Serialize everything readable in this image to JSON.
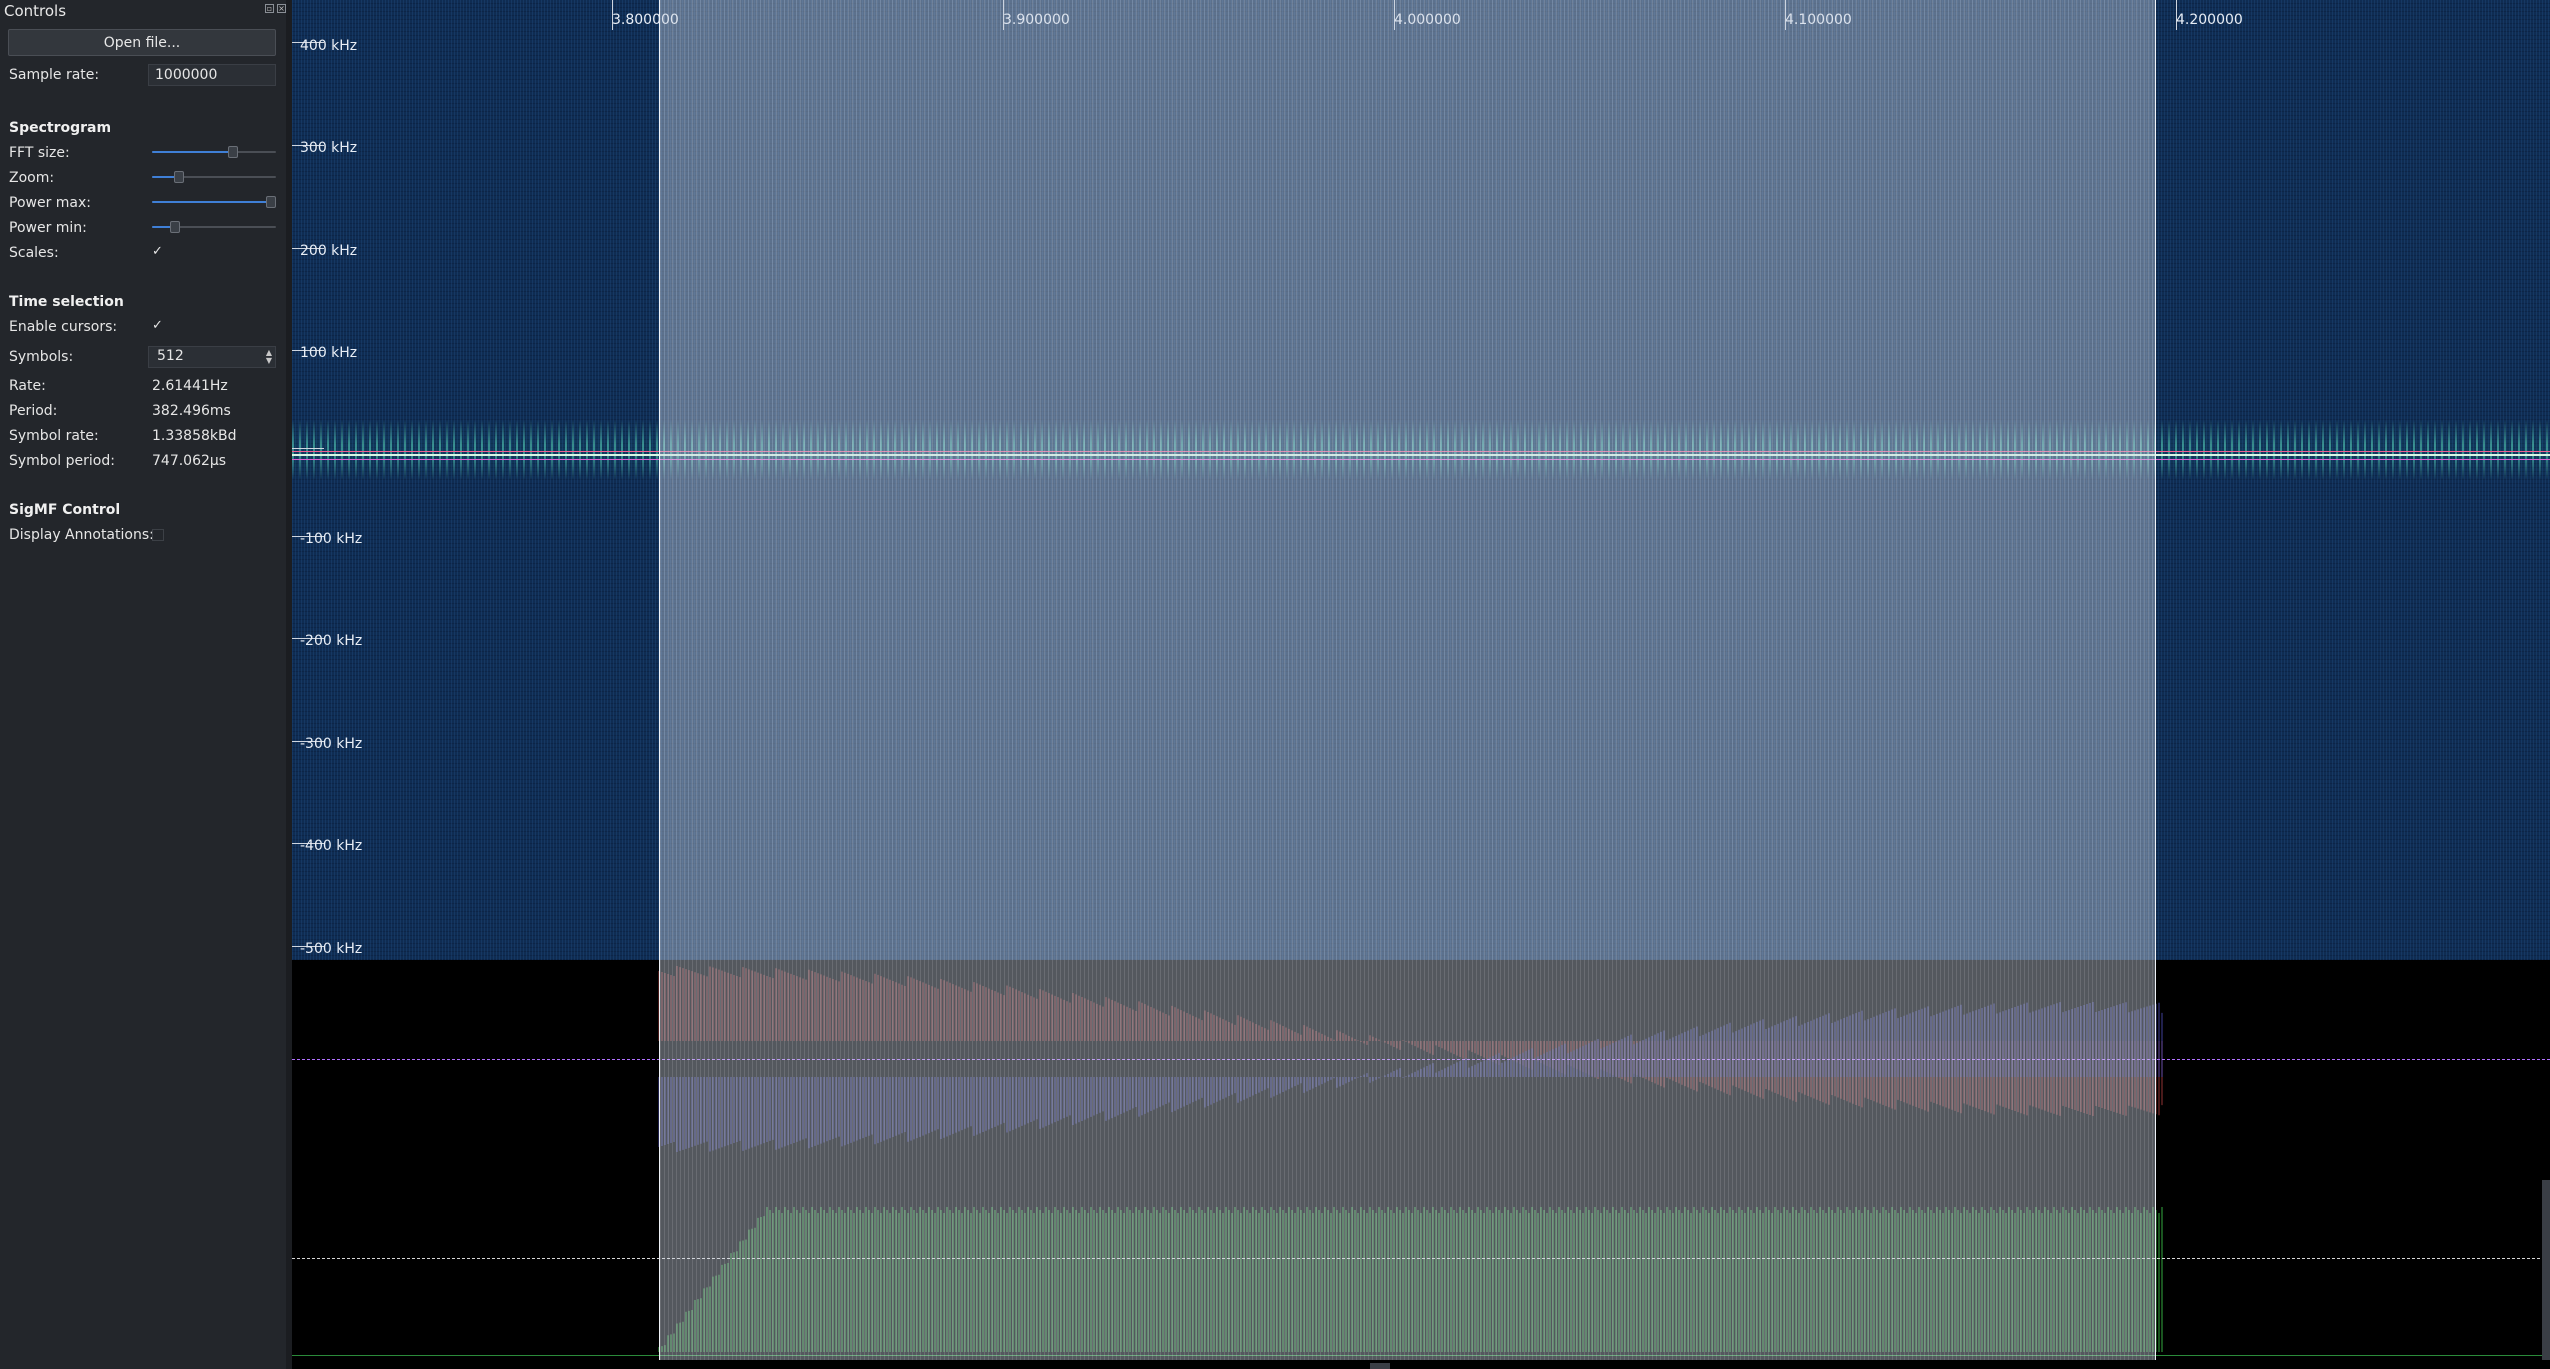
{
  "controls": {
    "title": "Controls",
    "open_file": "Open file...",
    "sample_rate_label": "Sample rate:",
    "sample_rate_value": "1000000",
    "spectrogram": {
      "heading": "Spectrogram",
      "fft_size_label": "FFT size:",
      "fft_size_level": 0.65,
      "zoom_label": "Zoom:",
      "zoom_level": 0.22,
      "power_max_label": "Power max:",
      "power_max_level": 1.0,
      "power_min_label": "Power min:",
      "power_min_level": 0.18,
      "scales_label": "Scales:",
      "scales_checked": "✓"
    },
    "time_selection": {
      "heading": "Time selection",
      "enable_cursors_label": "Enable cursors:",
      "enable_cursors_checked": "✓",
      "symbols_label": "Symbols:",
      "symbols_value": "512",
      "rate_label": "Rate:",
      "rate_value": "2.61441Hz",
      "period_label": "Period:",
      "period_value": "382.496ms",
      "symbol_rate_label": "Symbol rate:",
      "symbol_rate_value": "1.33858kBd",
      "symbol_period_label": "Symbol period:",
      "symbol_period_value": "747.062µs"
    },
    "sigmf": {
      "heading": "SigMF Control",
      "display_annotations_label": "Display Annotations:"
    }
  },
  "spectrogram": {
    "time_labels": [
      "3.800000",
      "3.900000",
      "4.000000",
      "4.100000",
      "4.200000"
    ],
    "freq_labels": [
      "400 kHz",
      "300 kHz",
      "200 kHz",
      "100 kHz",
      "-100 kHz",
      "-200 kHz",
      "-300 kHz",
      "-400 kHz",
      "-500 kHz"
    ],
    "background_color": "#0f2c52",
    "signal_color": "#5adcbe"
  },
  "plots": {
    "i_color": "#d04848",
    "q_color": "#5a5ad8",
    "amplitude_color": "#3ec84a"
  }
}
